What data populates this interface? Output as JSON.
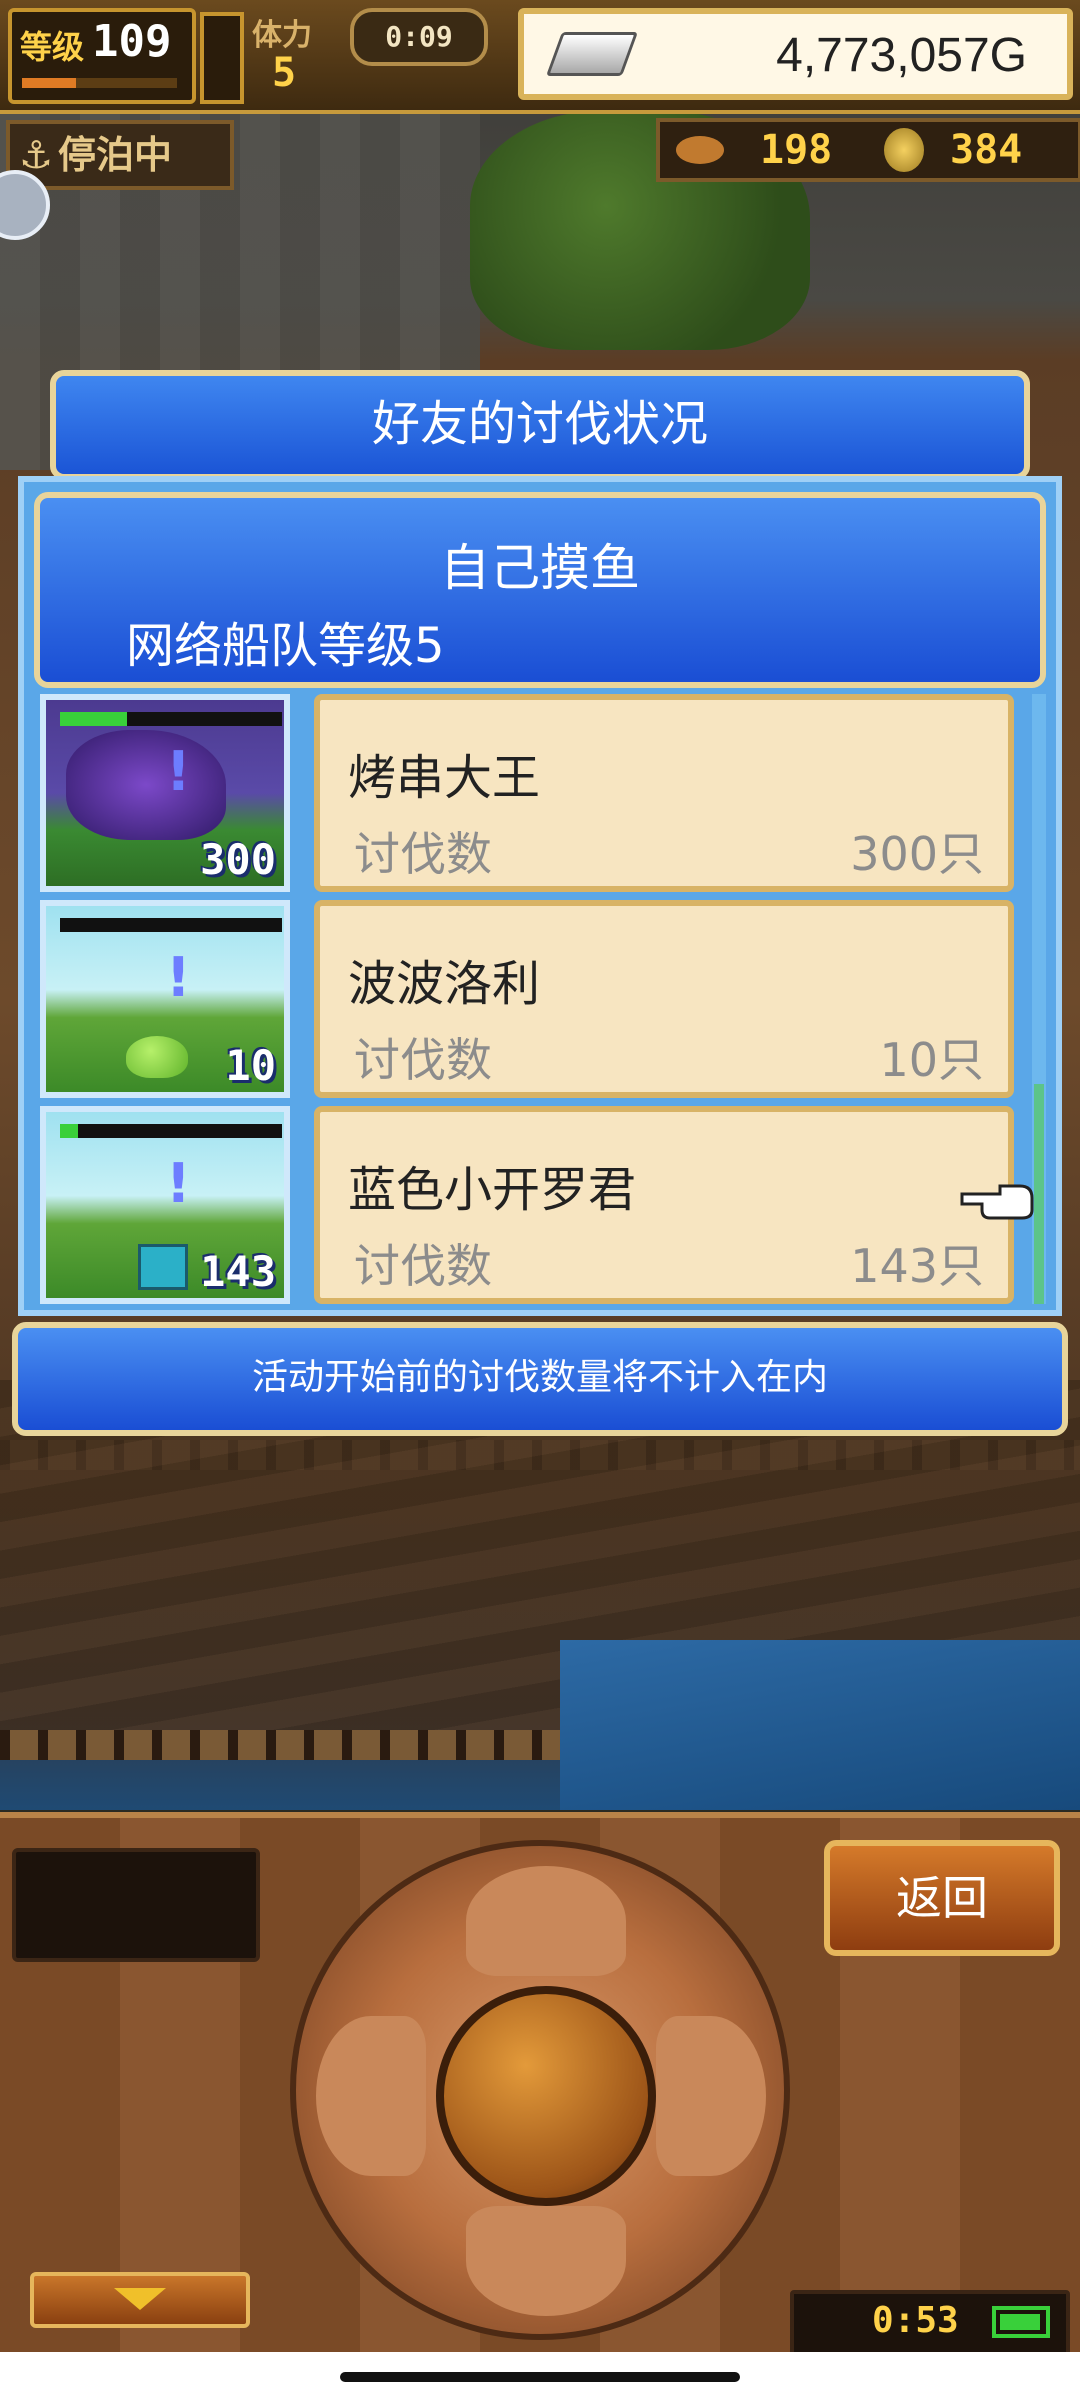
{
  "hud": {
    "level_label": "等级",
    "level_value": "109",
    "level_progress": 0.35,
    "stamina_label": "体力",
    "stamina_value": "5",
    "timer": "0:09",
    "gold": "4,773,057G",
    "anchor_label": "停泊中",
    "fish_count": "198",
    "coin_count": "384"
  },
  "dialog": {
    "title": "好友的讨伐状况",
    "header_name": "自己摸鱼",
    "header_sub": "网络船队等级5",
    "kill_label": "讨伐数",
    "entries": [
      {
        "name": "烤串大王",
        "kills": "300只",
        "thumb_count": "300",
        "hp": 0.3,
        "monster": "purple-caped-boss"
      },
      {
        "name": "波波洛利",
        "kills": "10只",
        "thumb_count": "10",
        "hp": 0.0,
        "monster": "green-slime"
      },
      {
        "name": "蓝色小开罗君",
        "kills": "143只",
        "thumb_count": "143",
        "hp": 0.08,
        "monster": "blue-robot"
      }
    ],
    "notice": "活动开始前的讨伐数量将不计入在内"
  },
  "controls": {
    "back_label": "返回",
    "clock": "0:53"
  }
}
